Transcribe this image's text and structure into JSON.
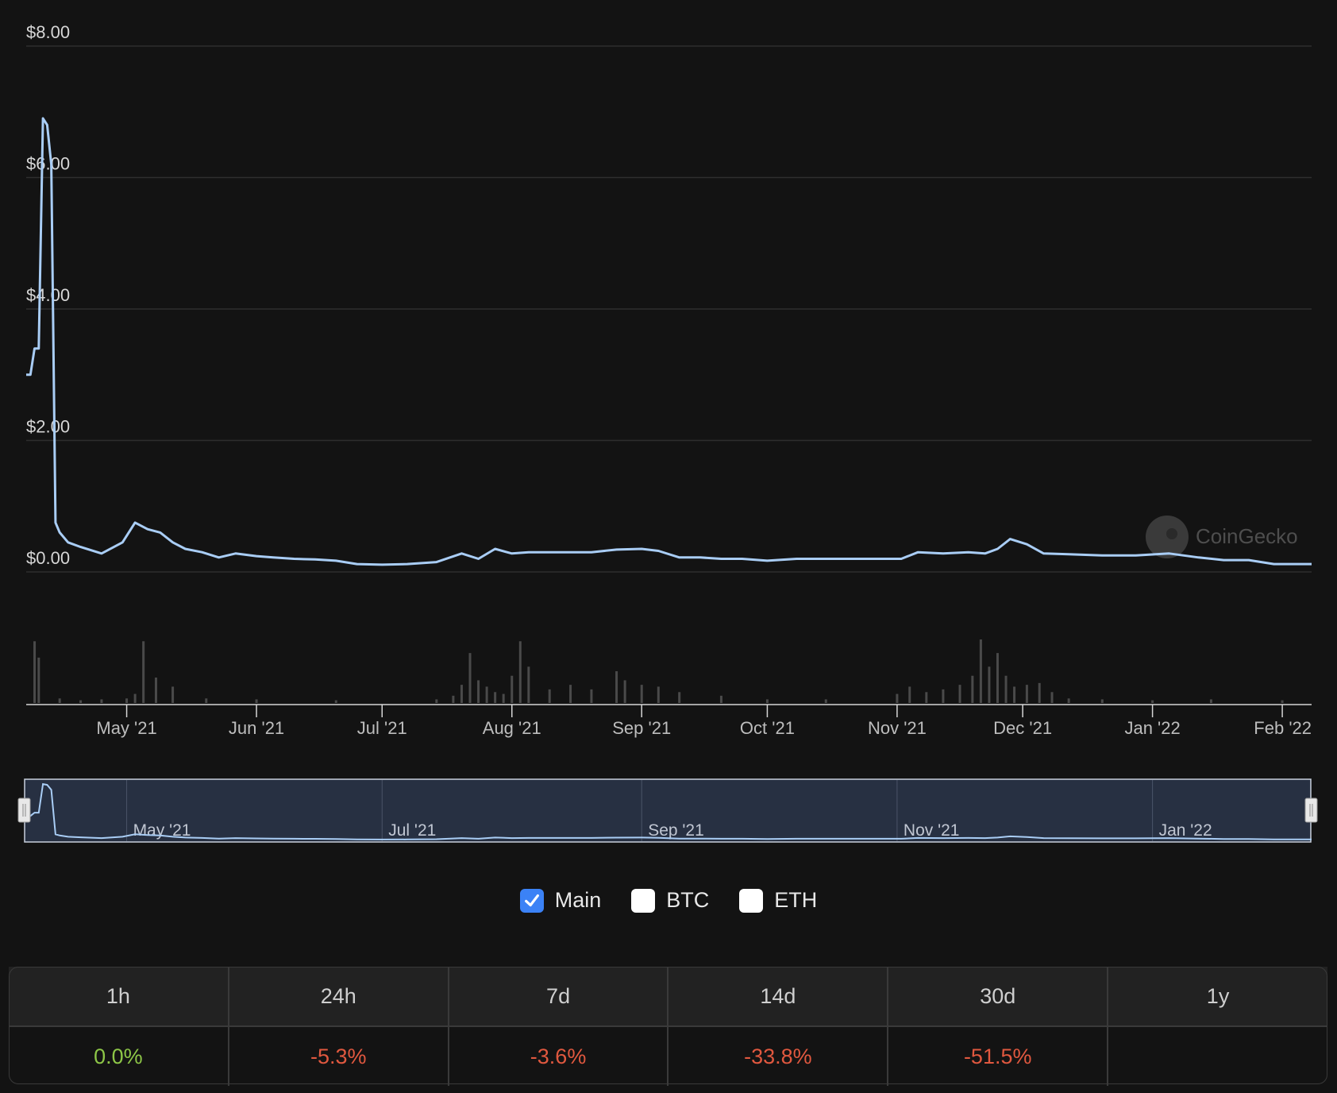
{
  "colors": {
    "line": "#a9cdf5",
    "grid": "#2e2e2e",
    "axis_text": "#d6d6d6",
    "volume": "#4a4a4a",
    "positive": "#8dc647",
    "negative": "#e0583f",
    "checkbox_checked": "#3b82f6",
    "navigator_fill": "#273042"
  },
  "watermark": "CoinGecko",
  "legend": [
    {
      "label": "Main",
      "checked": true
    },
    {
      "label": "BTC",
      "checked": false
    },
    {
      "label": "ETH",
      "checked": false
    }
  ],
  "performance": {
    "headers": [
      "1h",
      "24h",
      "7d",
      "14d",
      "30d",
      "1y"
    ],
    "values": [
      "0.0%",
      "-5.3%",
      "-3.6%",
      "-33.8%",
      "-51.5%",
      ""
    ]
  },
  "chart_data": {
    "type": "line",
    "title": "",
    "xlabel": "",
    "ylabel": "",
    "y_ticks": [
      "$0.00",
      "$2.00",
      "$4.00",
      "$6.00",
      "$8.00"
    ],
    "ylim": [
      0,
      8
    ],
    "x_ticks": [
      "May '21",
      "Jun '21",
      "Jul '21",
      "Aug '21",
      "Sep '21",
      "Oct '21",
      "Nov '21",
      "Dec '21",
      "Jan '22",
      "Feb '22"
    ],
    "xlim": [
      "2021-04-07",
      "2022-02-08"
    ],
    "navigator_ticks": [
      "May '21",
      "Jul '21",
      "Sep '21",
      "Nov '21",
      "Jan '22"
    ],
    "series": [
      {
        "x": [
          "2021-04-07",
          "2021-04-08",
          "2021-04-09",
          "2021-04-10",
          "2021-04-11",
          "2021-04-12",
          "2021-04-13",
          "2021-04-14",
          "2021-04-15",
          "2021-04-17",
          "2021-04-20",
          "2021-04-25",
          "2021-04-30",
          "2021-05-03",
          "2021-05-06",
          "2021-05-09",
          "2021-05-12",
          "2021-05-15",
          "2021-05-19",
          "2021-05-23",
          "2021-05-27",
          "2021-06-01",
          "2021-06-05",
          "2021-06-10",
          "2021-06-15",
          "2021-06-20",
          "2021-06-25",
          "2021-07-01",
          "2021-07-07",
          "2021-07-14",
          "2021-07-20",
          "2021-07-24",
          "2021-07-28",
          "2021-08-01",
          "2021-08-05",
          "2021-08-10",
          "2021-08-15",
          "2021-08-20",
          "2021-08-26",
          "2021-09-01",
          "2021-09-05",
          "2021-09-10",
          "2021-09-15",
          "2021-09-20",
          "2021-09-25",
          "2021-10-01",
          "2021-10-08",
          "2021-10-15",
          "2021-10-22",
          "2021-10-29",
          "2021-11-02",
          "2021-11-06",
          "2021-11-12",
          "2021-11-18",
          "2021-11-22",
          "2021-11-25",
          "2021-11-28",
          "2021-12-02",
          "2021-12-06",
          "2021-12-12",
          "2021-12-20",
          "2021-12-28",
          "2022-01-05",
          "2022-01-12",
          "2022-01-18",
          "2022-01-24",
          "2022-01-30",
          "2022-02-08"
        ],
        "y": [
          3.0,
          3.0,
          3.4,
          3.4,
          6.9,
          6.8,
          6.2,
          0.75,
          0.6,
          0.45,
          0.38,
          0.28,
          0.45,
          0.75,
          0.65,
          0.6,
          0.45,
          0.35,
          0.3,
          0.22,
          0.28,
          0.24,
          0.22,
          0.2,
          0.19,
          0.17,
          0.12,
          0.11,
          0.12,
          0.15,
          0.28,
          0.2,
          0.35,
          0.28,
          0.3,
          0.3,
          0.3,
          0.3,
          0.34,
          0.35,
          0.32,
          0.22,
          0.22,
          0.2,
          0.2,
          0.17,
          0.2,
          0.2,
          0.2,
          0.2,
          0.2,
          0.3,
          0.28,
          0.3,
          0.28,
          0.35,
          0.5,
          0.42,
          0.28,
          0.27,
          0.25,
          0.25,
          0.28,
          0.22,
          0.18,
          0.18,
          0.12,
          0.12
        ]
      }
    ],
    "volume_series": {
      "x": [
        "2021-04-09",
        "2021-04-10",
        "2021-04-15",
        "2021-04-20",
        "2021-04-25",
        "2021-05-01",
        "2021-05-03",
        "2021-05-05",
        "2021-05-08",
        "2021-05-12",
        "2021-05-20",
        "2021-06-01",
        "2021-06-20",
        "2021-07-14",
        "2021-07-18",
        "2021-07-20",
        "2021-07-22",
        "2021-07-24",
        "2021-07-26",
        "2021-07-28",
        "2021-07-30",
        "2021-08-01",
        "2021-08-03",
        "2021-08-05",
        "2021-08-10",
        "2021-08-15",
        "2021-08-20",
        "2021-08-26",
        "2021-08-28",
        "2021-09-01",
        "2021-09-05",
        "2021-09-10",
        "2021-09-20",
        "2021-10-01",
        "2021-10-15",
        "2021-11-01",
        "2021-11-04",
        "2021-11-08",
        "2021-11-12",
        "2021-11-16",
        "2021-11-19",
        "2021-11-21",
        "2021-11-23",
        "2021-11-25",
        "2021-11-27",
        "2021-11-29",
        "2021-12-02",
        "2021-12-05",
        "2021-12-08",
        "2021-12-12",
        "2021-12-20",
        "2022-01-01",
        "2022-01-15",
        "2022-02-01"
      ],
      "y": [
        68,
        50,
        5,
        3,
        4,
        5,
        10,
        68,
        28,
        18,
        5,
        4,
        3,
        4,
        8,
        20,
        55,
        25,
        18,
        12,
        10,
        30,
        68,
        40,
        15,
        20,
        15,
        35,
        25,
        20,
        18,
        12,
        8,
        4,
        4,
        10,
        18,
        12,
        15,
        20,
        30,
        70,
        40,
        55,
        30,
        18,
        20,
        22,
        12,
        5,
        4,
        3,
        4,
        3
      ]
    }
  }
}
